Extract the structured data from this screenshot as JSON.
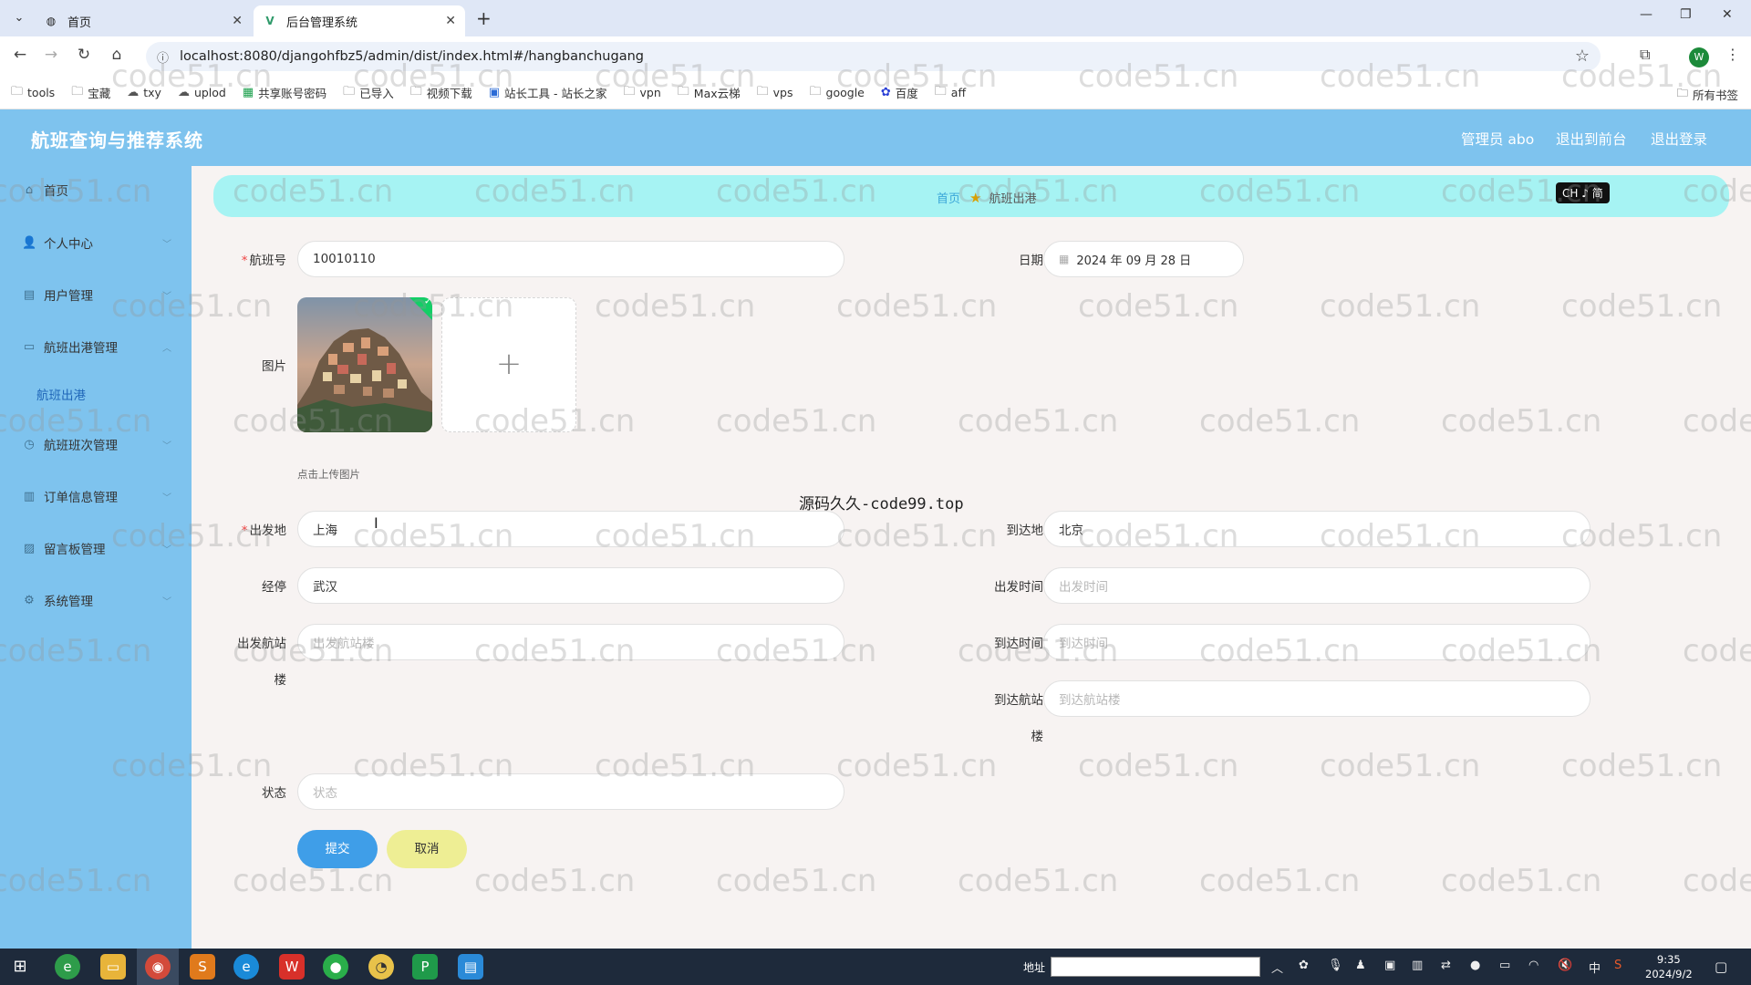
{
  "browser": {
    "tabs": [
      {
        "label": "首页",
        "icon": "globe-icon"
      },
      {
        "label": "后台管理系统",
        "icon": "vue-logo-icon"
      }
    ],
    "url": "localhost:8080/djangohfbz5/admin/dist/index.html#/hangbanchugang",
    "profile_initial": "W",
    "bookmarks": [
      {
        "label": "tools",
        "icon": "folder-icon"
      },
      {
        "label": "宝藏",
        "icon": "folder-icon"
      },
      {
        "label": "txy",
        "icon": "cloud-icon"
      },
      {
        "label": "uplod",
        "icon": "cloud-icon"
      },
      {
        "label": "共享账号密码",
        "icon": "sheet-icon"
      },
      {
        "label": "已导入",
        "icon": "folder-icon"
      },
      {
        "label": "视频下载",
        "icon": "folder-icon"
      },
      {
        "label": "站长工具 - 站长之家",
        "icon": "site-icon"
      },
      {
        "label": "vpn",
        "icon": "folder-icon"
      },
      {
        "label": "Max云梯",
        "icon": "folder-icon"
      },
      {
        "label": "vps",
        "icon": "folder-icon"
      },
      {
        "label": "google",
        "icon": "folder-icon"
      },
      {
        "label": "百度",
        "icon": "baidu-icon"
      },
      {
        "label": "aff",
        "icon": "folder-icon"
      }
    ],
    "all_bookmarks": "所有书签"
  },
  "header": {
    "title": "航班查询与推荐系统",
    "admin": "管理员 abo",
    "to_front": "退出到前台",
    "logout": "退出登录"
  },
  "sidebar": {
    "items": [
      {
        "label": "首页",
        "icon": "home-icon"
      },
      {
        "label": "个人中心",
        "icon": "user-icon"
      },
      {
        "label": "用户管理",
        "icon": "users-icon"
      },
      {
        "label": "航班出港管理",
        "icon": "plane-icon"
      },
      {
        "label": "航班班次管理",
        "icon": "clock-icon"
      },
      {
        "label": "订单信息管理",
        "icon": "order-icon"
      },
      {
        "label": "留言板管理",
        "icon": "message-icon"
      },
      {
        "label": "系统管理",
        "icon": "gear-icon"
      }
    ],
    "sub_item": "航班出港"
  },
  "breadcrumb": {
    "home": "首页",
    "current": "航班出港"
  },
  "ime": "CH ♪ 简",
  "form": {
    "flight_no": {
      "label": "航班号",
      "value": "10010110"
    },
    "date": {
      "label": "日期",
      "value": "2024 年 09 月 28 日"
    },
    "image": {
      "label": "图片",
      "upload_tip": "点击上传图片"
    },
    "departure": {
      "label": "出发地",
      "value": "上海"
    },
    "arrival": {
      "label": "到达地",
      "value": "北京"
    },
    "stopover": {
      "label": "经停",
      "value": "武汉"
    },
    "depart_time": {
      "label": "出发时间",
      "placeholder": "出发时间"
    },
    "depart_terminal": {
      "label_1": "出发航站",
      "label_2": "楼",
      "placeholder": "出发航站楼"
    },
    "arrive_time": {
      "label": "到达时间",
      "placeholder": "到达时间"
    },
    "arrive_terminal": {
      "label_1": "到达航站",
      "label_2": "楼",
      "placeholder": "到达航站楼"
    },
    "status": {
      "label": "状态",
      "placeholder": "状态"
    },
    "submit": "提交",
    "cancel": "取消"
  },
  "center_note": "源码久久-code99.top",
  "watermark": "code51.cn",
  "taskbar": {
    "address_label": "地址",
    "time": "9:35",
    "date": "2024/9/2",
    "ime_lang": "中"
  },
  "colors": {
    "accent": "#7ec3ee",
    "breadcrumb_bg": "#a6f3f3",
    "submit": "#3f9ee8",
    "cancel": "#eeee94"
  }
}
